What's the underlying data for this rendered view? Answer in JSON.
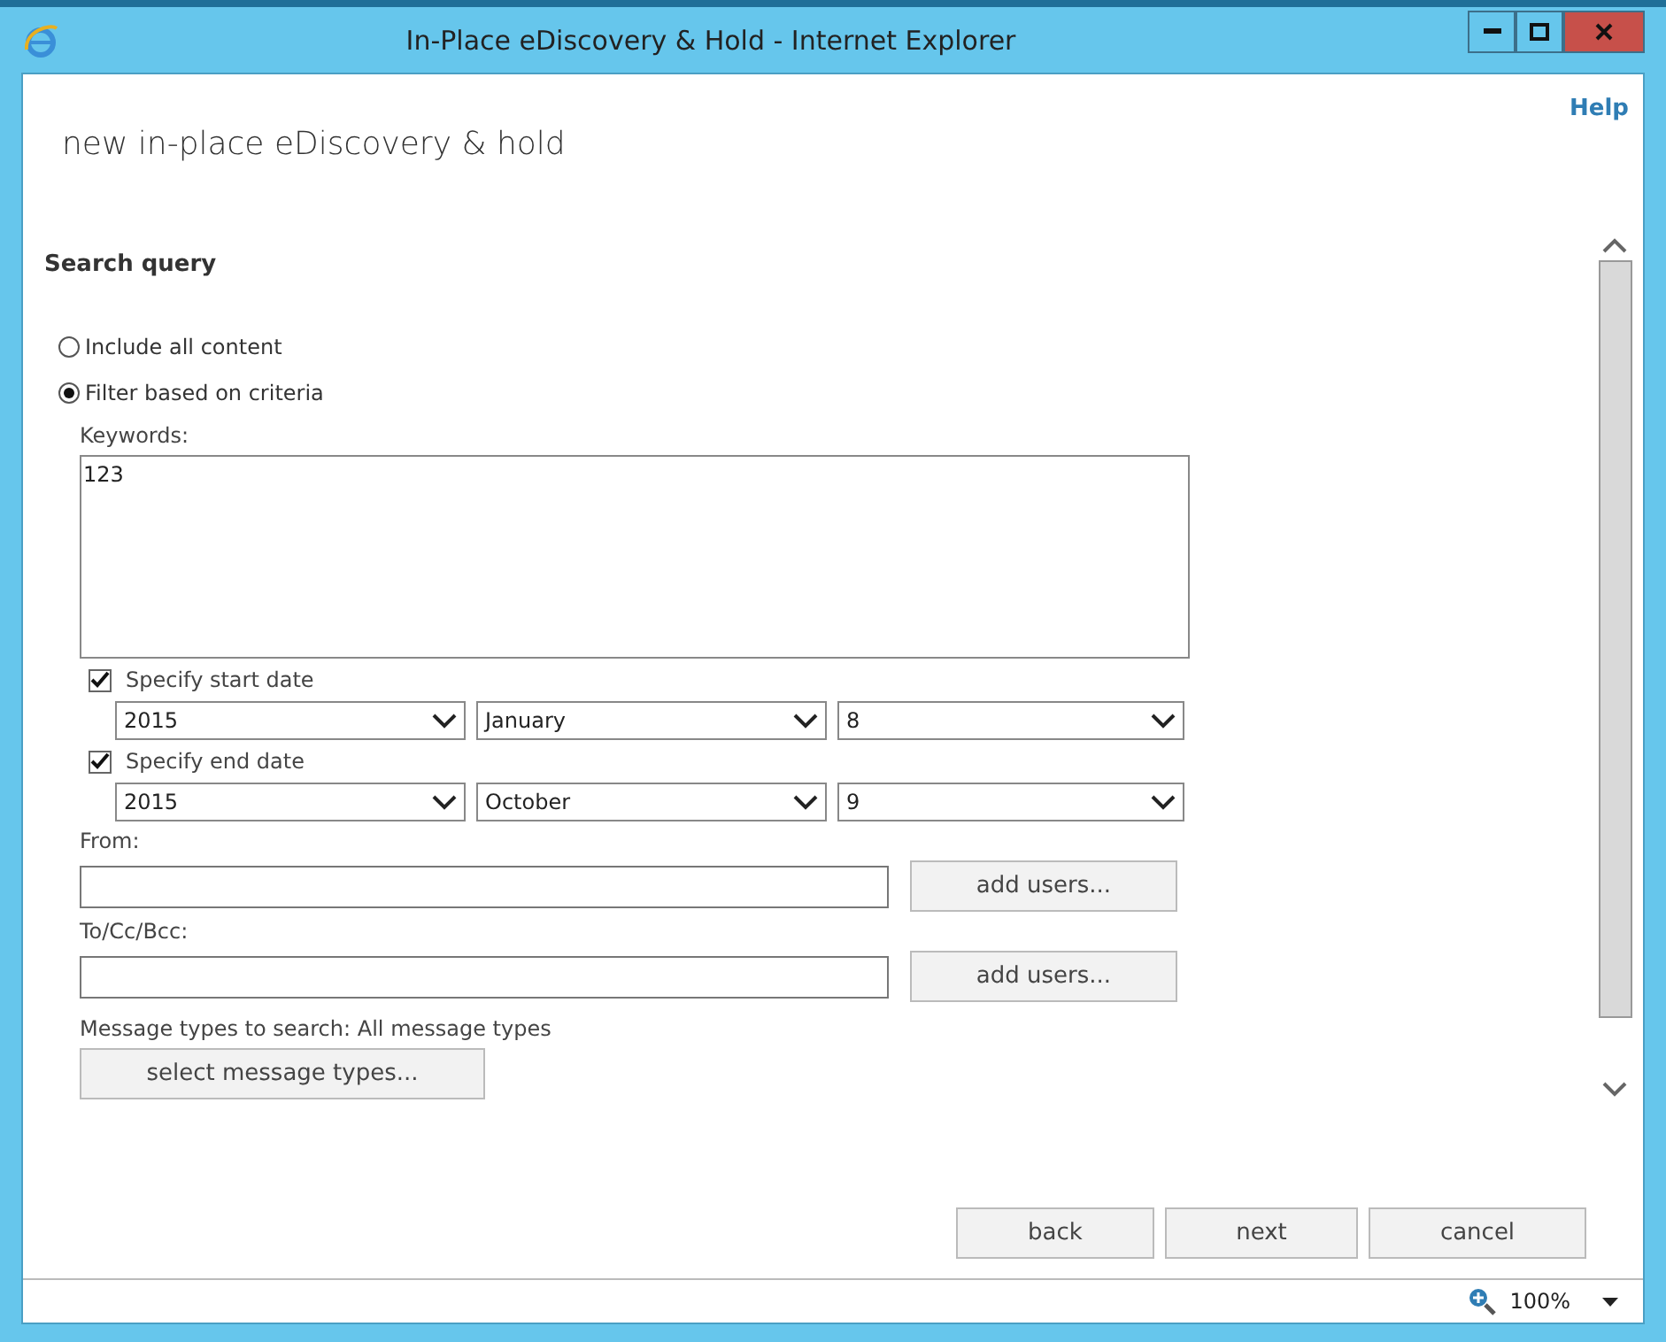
{
  "window": {
    "title": "In-Place eDiscovery & Hold - Internet Explorer"
  },
  "help": "Help",
  "heading": "new in-place eDiscovery & hold",
  "section_title": "Search query",
  "radios": [
    {
      "label": "Include all content",
      "selected": false
    },
    {
      "label": "Filter based on criteria",
      "selected": true
    }
  ],
  "keywords": {
    "label": "Keywords:",
    "value": "123"
  },
  "date_filters": [
    {
      "label": "Specify start date",
      "checked": true,
      "year": "2015",
      "month": "January",
      "day": "8"
    },
    {
      "label": "Specify end date",
      "checked": true,
      "year": "2015",
      "month": "October",
      "day": "9"
    }
  ],
  "recipient_fields": [
    {
      "label": "From:",
      "button": "add users..."
    },
    {
      "label": "To/Cc/Bcc:",
      "button": "add users..."
    }
  ],
  "message_types": {
    "label": "Message types to search:",
    "value": "All message types",
    "button": "select message types..."
  },
  "buttons": [
    "back",
    "next",
    "cancel"
  ],
  "status_bar": {
    "zoom": "100%"
  }
}
